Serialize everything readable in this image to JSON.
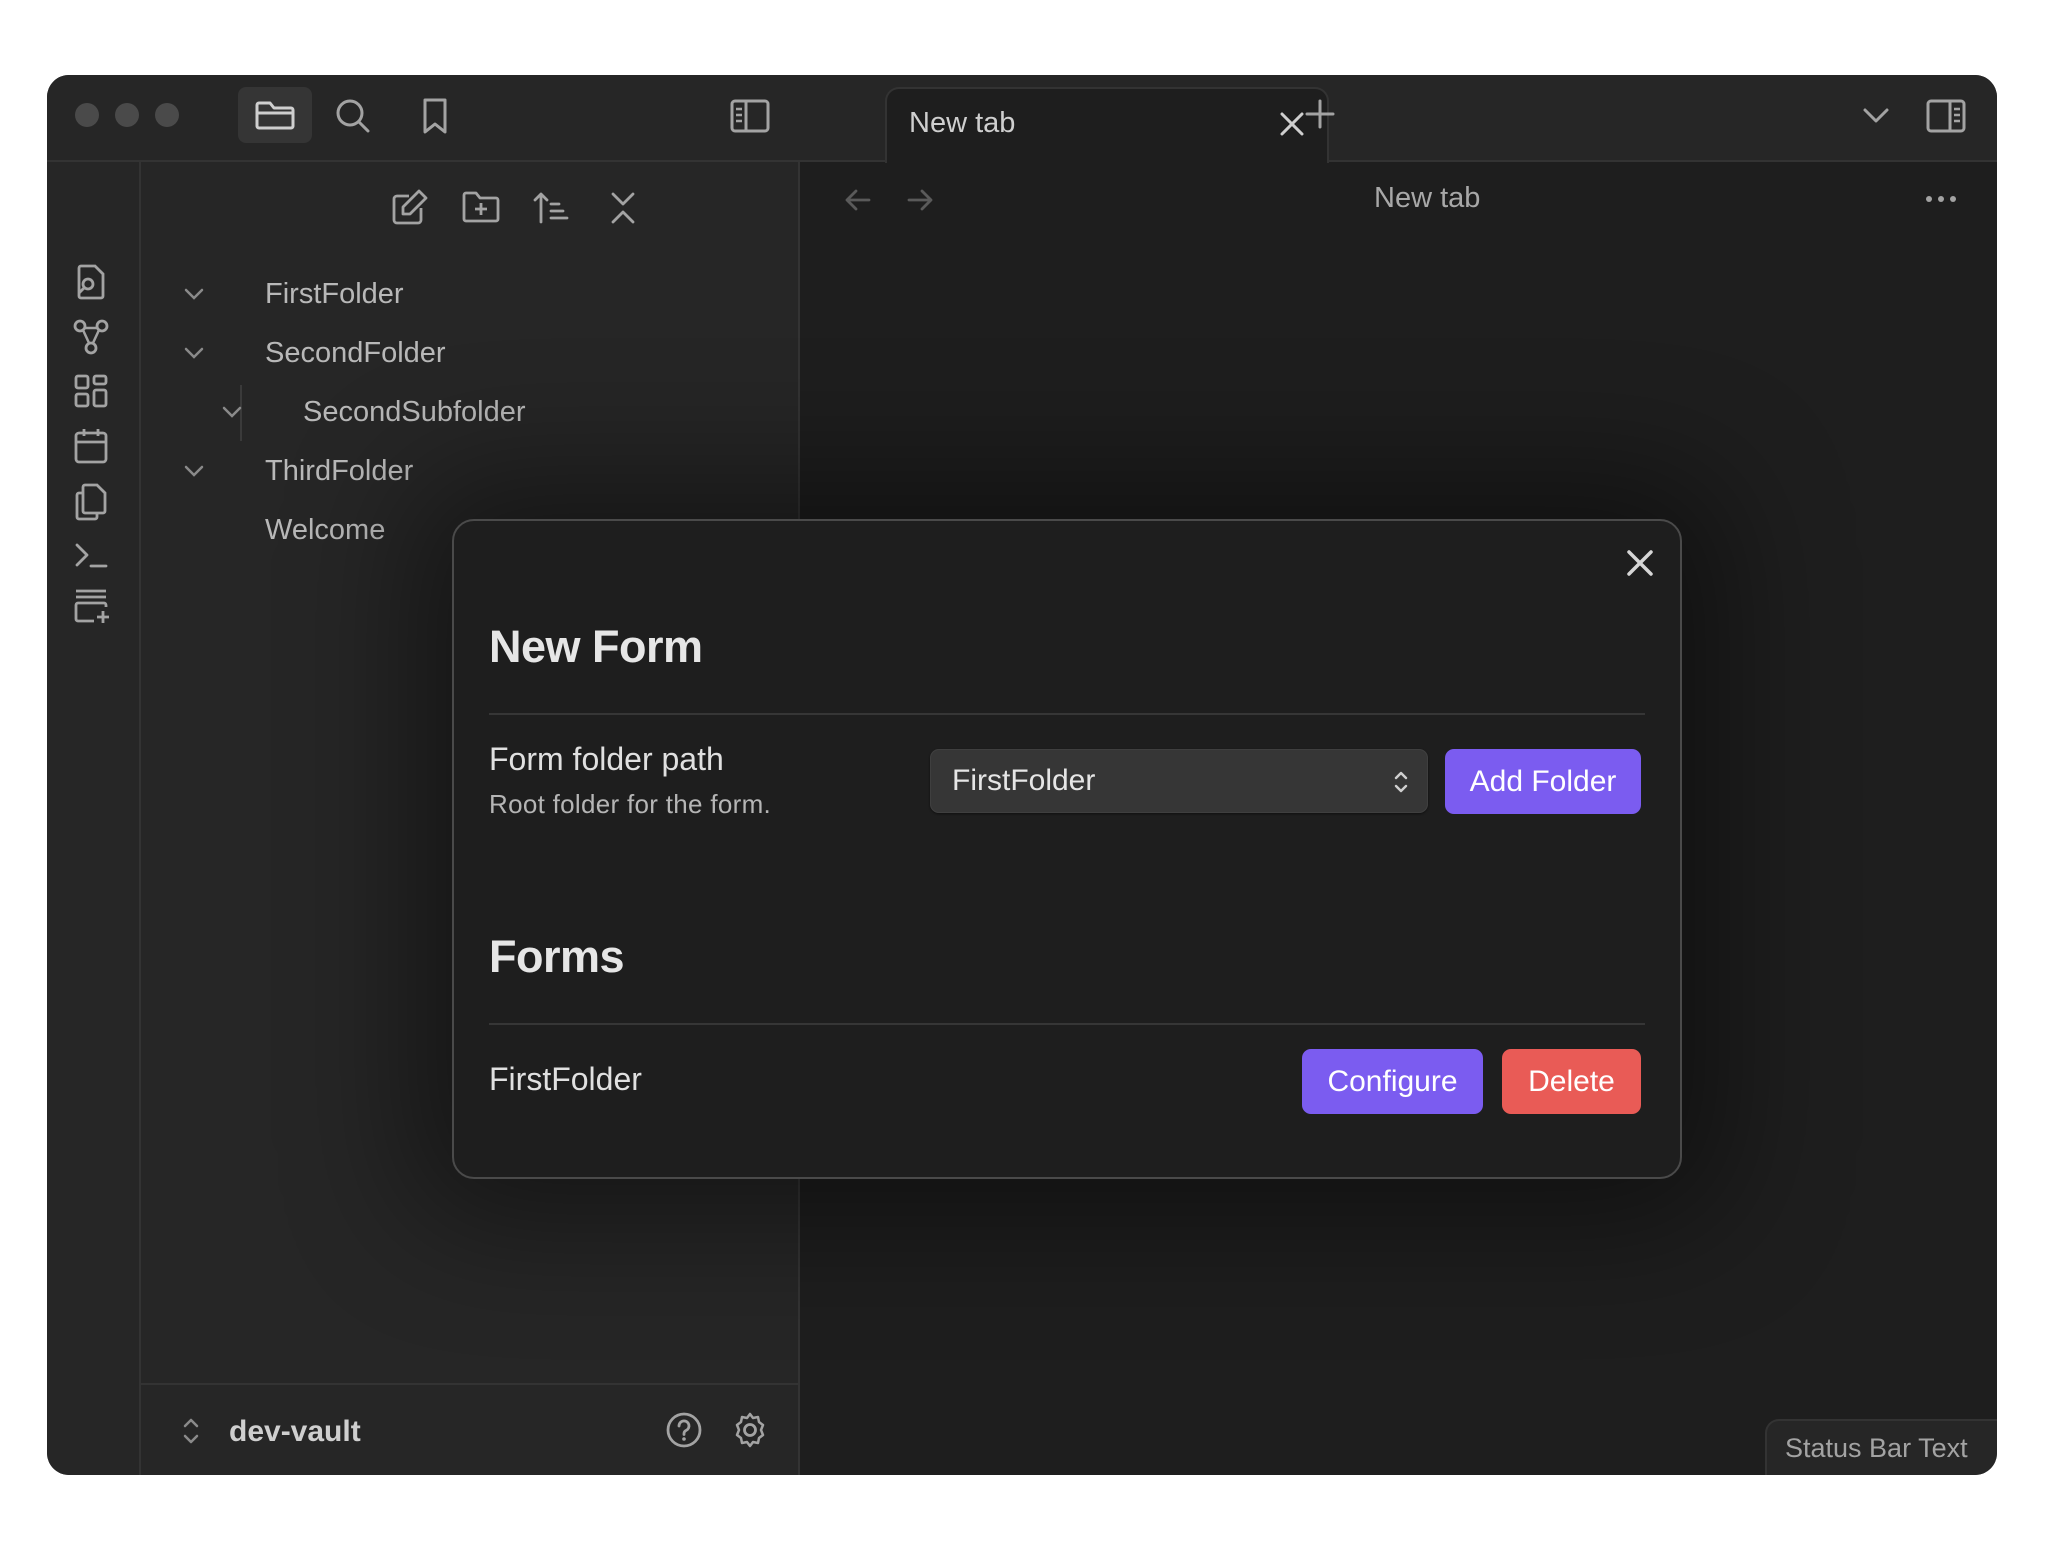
{
  "window": {
    "tab": {
      "title": "New tab"
    },
    "nav": {
      "title": "New tab"
    }
  },
  "sidebar": {
    "tree": [
      {
        "label": "FirstFolder",
        "expanded": true
      },
      {
        "label": "SecondFolder",
        "expanded": true
      },
      {
        "label": "SecondSubfolder",
        "expanded": true
      },
      {
        "label": "ThirdFolder",
        "expanded": true
      },
      {
        "label": "Welcome"
      }
    ],
    "vault_name": "dev-vault"
  },
  "status_bar": {
    "text": "Status Bar Text"
  },
  "modal": {
    "title": "New Form",
    "setting": {
      "name": "Form folder path",
      "description": "Root folder for the form.",
      "select_value": "FirstFolder",
      "add_button": "Add Folder"
    },
    "forms_heading": "Forms",
    "forms": [
      {
        "name": "FirstFolder",
        "configure_label": "Configure",
        "delete_label": "Delete"
      }
    ]
  },
  "colors": {
    "accent": "#7b5cf0",
    "danger": "#e95b56",
    "background": "#1e1e1e",
    "sidebar": "#262626"
  }
}
